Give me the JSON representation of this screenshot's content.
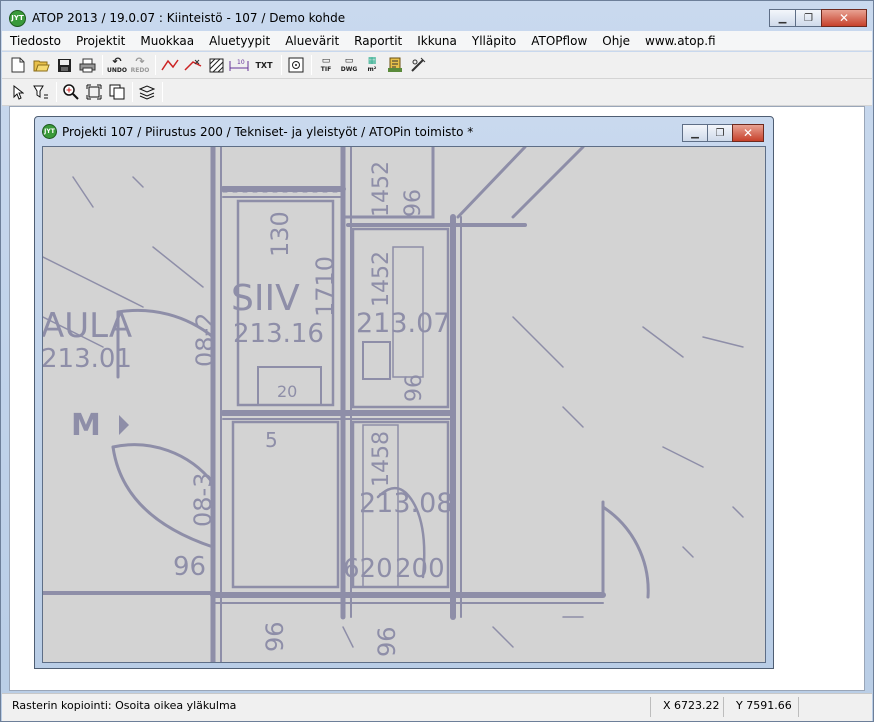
{
  "app": {
    "title": "ATOP 2013 / 19.0.07 : Kiinteistö - 107 / Demo kohde",
    "icon_text": "JYT"
  },
  "menu": [
    "Tiedosto",
    "Projektit",
    "Muokkaa",
    "Aluetyypit",
    "Aluevärit",
    "Raportit",
    "Ikkuna",
    "Ylläpito",
    "ATOPflow",
    "Ohje",
    "www.atop.fi"
  ],
  "toolbar1": {
    "undo_label": "UNDO",
    "redo_label": "REDO",
    "txt_label": "TXT",
    "tif_label": "TIF",
    "dwg_label": "DWG",
    "m2_label": "m²"
  },
  "child": {
    "title": "Projekti 107 / Piirustus 200 / Tekniset- ja yleistyöt / ATOPin toimisto *",
    "icon_text": "JYT"
  },
  "drawing_labels": {
    "aula": "AULA",
    "aula_num": "213.01",
    "m_arrow": "M",
    "siiv": "SIIV",
    "r21316": "213.16",
    "r213_07": "213.07",
    "r213_08": "213.08",
    "n130": "130",
    "n1710": "1710",
    "n96a": "96",
    "n96b": "96",
    "n96c": "96",
    "n96d": "96",
    "n96e": "96",
    "n08_2": "08-2",
    "n08_3": "08-3",
    "n1452": "1452",
    "n1452b": "1452",
    "n1458": "1458",
    "n620": "620",
    "n200": "200",
    "n5": "5",
    "n20": "20"
  },
  "status": {
    "message": "Rasterin kopiointi: Osoita oikea yläkulma",
    "x": "X 6723.22",
    "y": "Y 7591.66",
    "extra": ""
  },
  "colors": {
    "drawing_ink": "#8e8ea8",
    "canvas_bg": "#d3d3d3"
  }
}
